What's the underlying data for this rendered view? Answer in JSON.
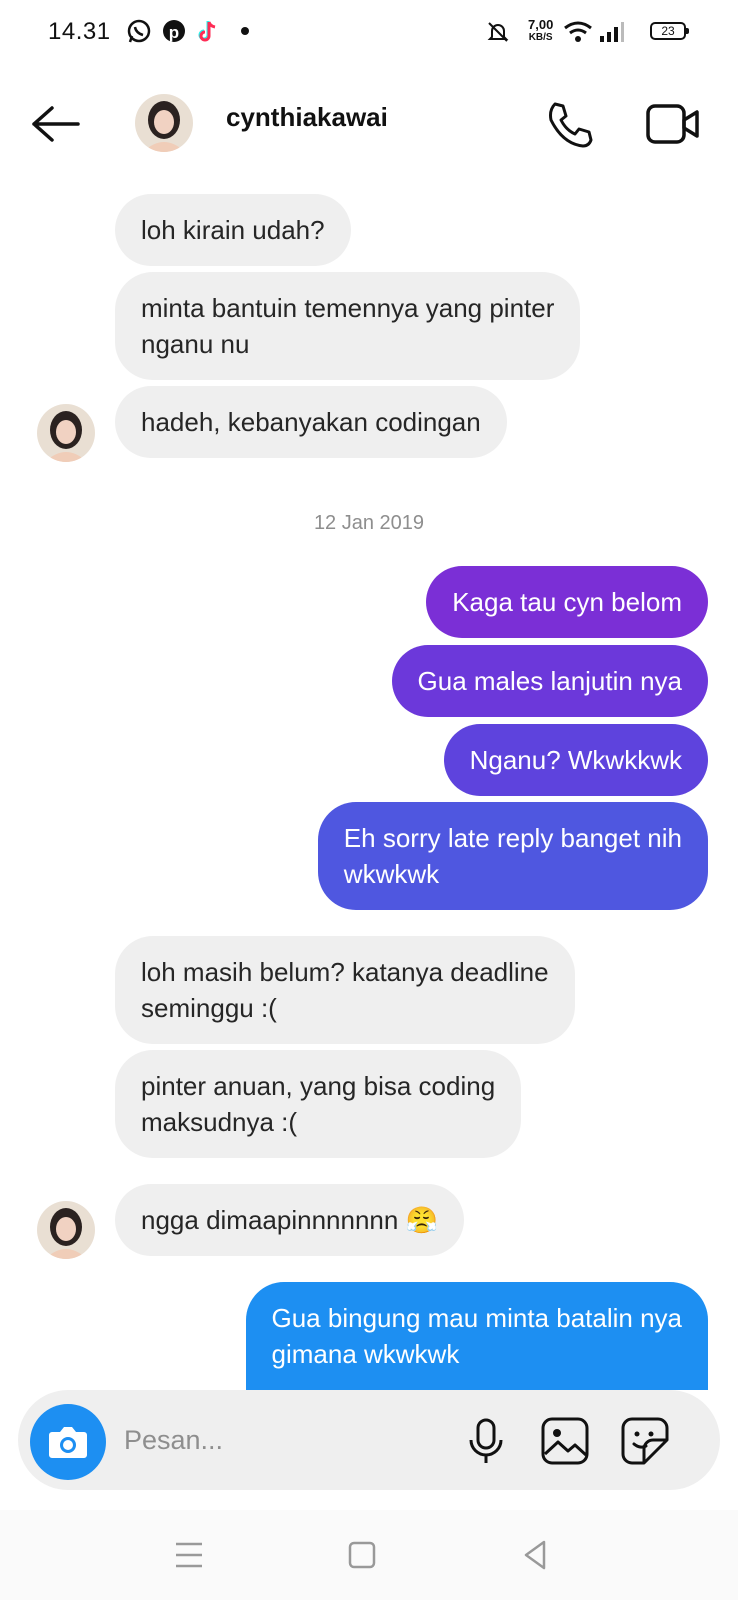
{
  "status_bar": {
    "time": "14.31",
    "net_speed_value": "7,00",
    "net_speed_unit": "KB/S",
    "battery": "23"
  },
  "header": {
    "username": "cynthiakawai"
  },
  "messages": {
    "m1": "loh kirain udah?",
    "m2_line1": "minta bantuin temennya yang pinter",
    "m2_line2": "nganu nu",
    "m3": "hadeh, kebanyakan codingan",
    "date_separator": "12 Jan 2019",
    "m4": "Kaga tau cyn belom",
    "m5": "Gua males lanjutin nya",
    "m6": "Nganu? Wkwkkwk",
    "m7_line1": "Eh sorry late reply banget nih",
    "m7_line2": "wkwkwk",
    "m8_line1": "loh masih belum? katanya deadline",
    "m8_line2": "seminggu :(",
    "m9_line1": "pinter anuan, yang bisa coding",
    "m9_line2": "maksudnya :(",
    "m10": "ngga dimaapinnnnnnn 😤",
    "m11_line1": "Gua bingung mau minta batalin nya",
    "m11_line2": "gimana wkwkwk"
  },
  "composer": {
    "placeholder": "Pesan..."
  },
  "colors": {
    "incoming_bubble": "#efefef",
    "outgoing_purple": "#7b2fd6",
    "outgoing_indigo": "#4f57e0",
    "outgoing_blue": "#1d8ff2",
    "camera_button": "#1d8ff2"
  },
  "icons": [
    "whatsapp-icon",
    "pinterest-icon",
    "tiktok-icon",
    "mute-icon",
    "wifi-icon",
    "signal-icon",
    "back-arrow-icon",
    "phone-icon",
    "video-icon",
    "camera-icon",
    "mic-icon",
    "gallery-icon",
    "sticker-icon",
    "menu-icon",
    "home-icon",
    "back-icon"
  ]
}
